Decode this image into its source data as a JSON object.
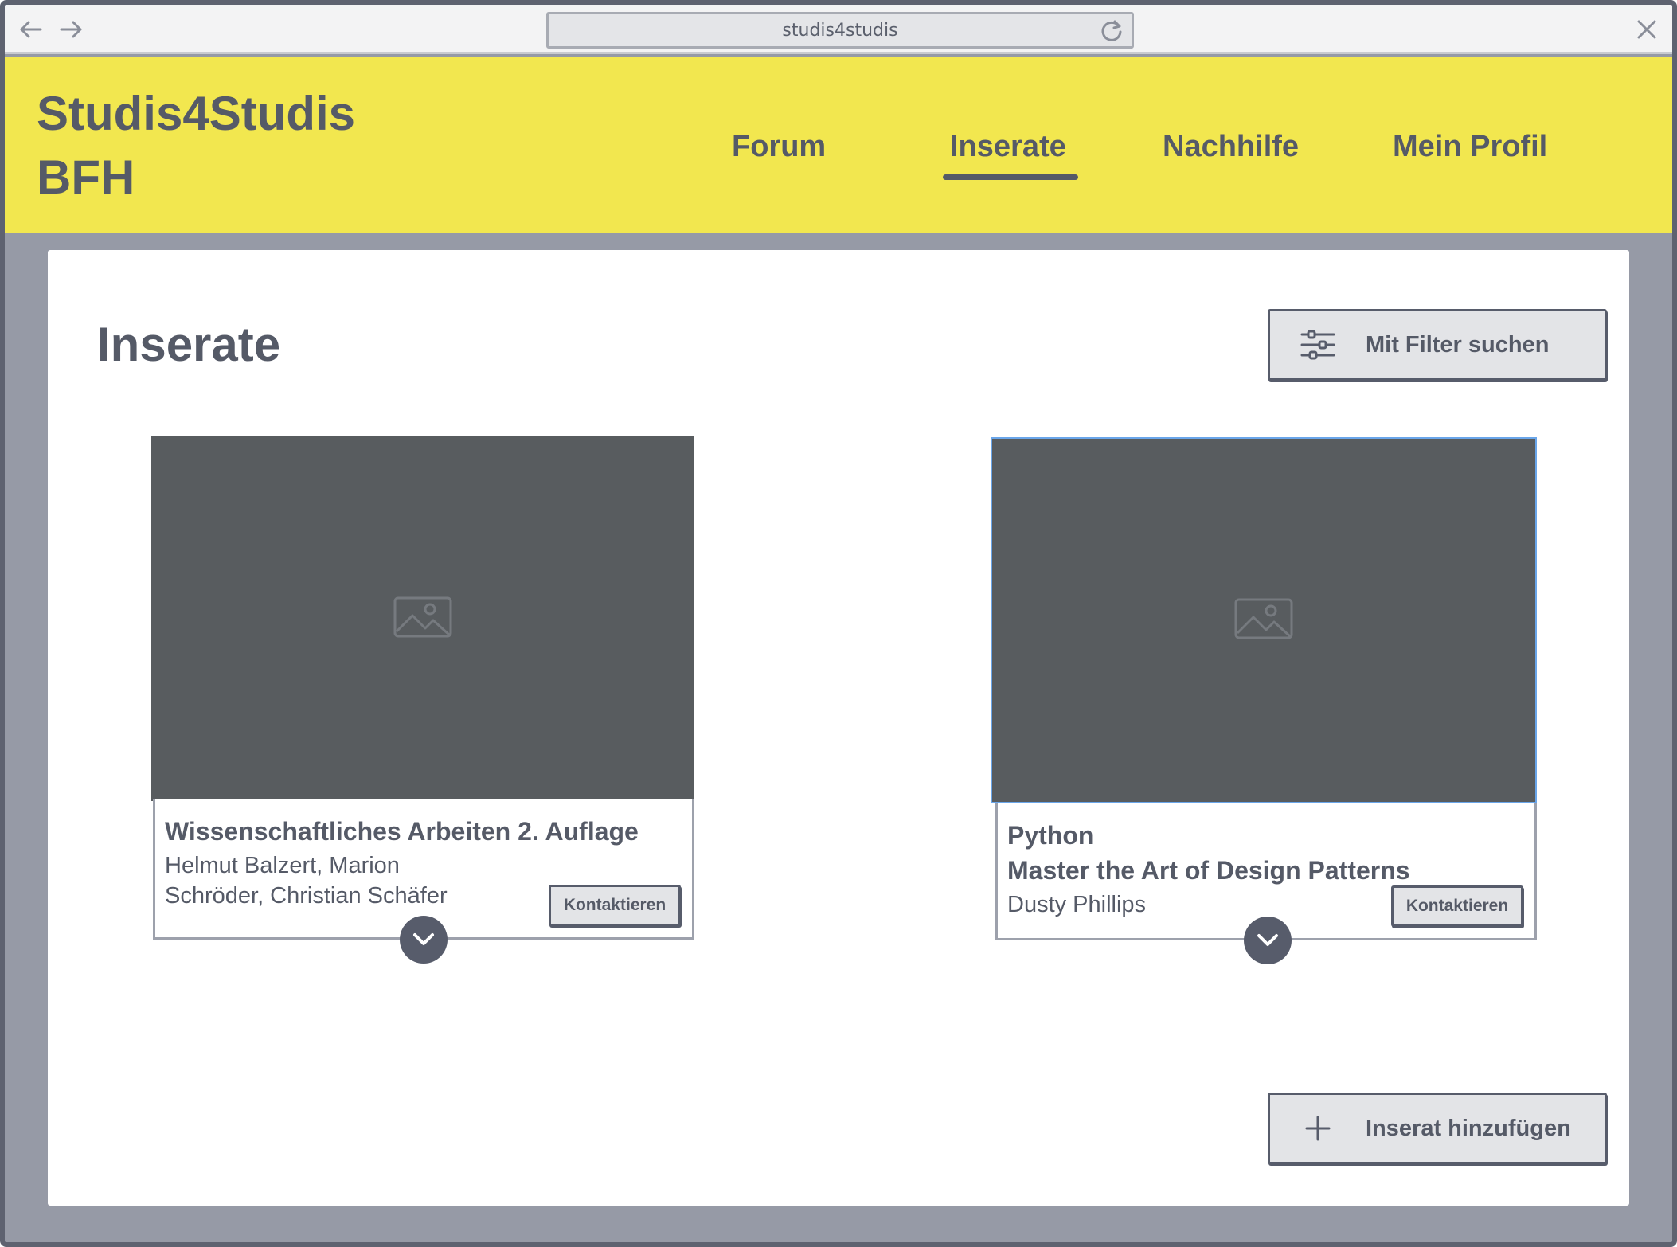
{
  "browser": {
    "url": "studis4studis",
    "icons": [
      "back-arrow-icon",
      "forward-arrow-icon",
      "reload-icon",
      "close-icon"
    ]
  },
  "header": {
    "brand_line1": "Studis4Studis",
    "brand_line2": "BFH",
    "nav": [
      {
        "label": "Forum"
      },
      {
        "label": "Inserate",
        "active": true
      },
      {
        "label": "Nachhilfe"
      },
      {
        "label": "Mein Profil"
      }
    ],
    "background_color": "#f2e74f"
  },
  "main": {
    "title": "Inserate",
    "filter_button": {
      "label": "Mit Filter suchen",
      "icon": "sliders-icon"
    },
    "add_button": {
      "label": "Inserat hinzufügen",
      "icon": "plus-icon"
    },
    "listings": [
      {
        "title_line1": "Wissenschaftliches Arbeiten 2. Auflage",
        "authors_line1": "Helmut Balzert, Marion",
        "authors_line2": "Schröder, Christian Schäfer",
        "contact_label": "Kontaktieren",
        "image_icon": "image-placeholder-icon",
        "expand_icon": "chevron-down-icon"
      },
      {
        "title_line1": "Python",
        "title_line2": "Master the Art of Design Patterns",
        "authors_line1": "Dusty Phillips",
        "contact_label": "Kontaktieren",
        "image_icon": "image-placeholder-icon",
        "expand_icon": "chevron-down-icon",
        "selected": true
      }
    ]
  }
}
